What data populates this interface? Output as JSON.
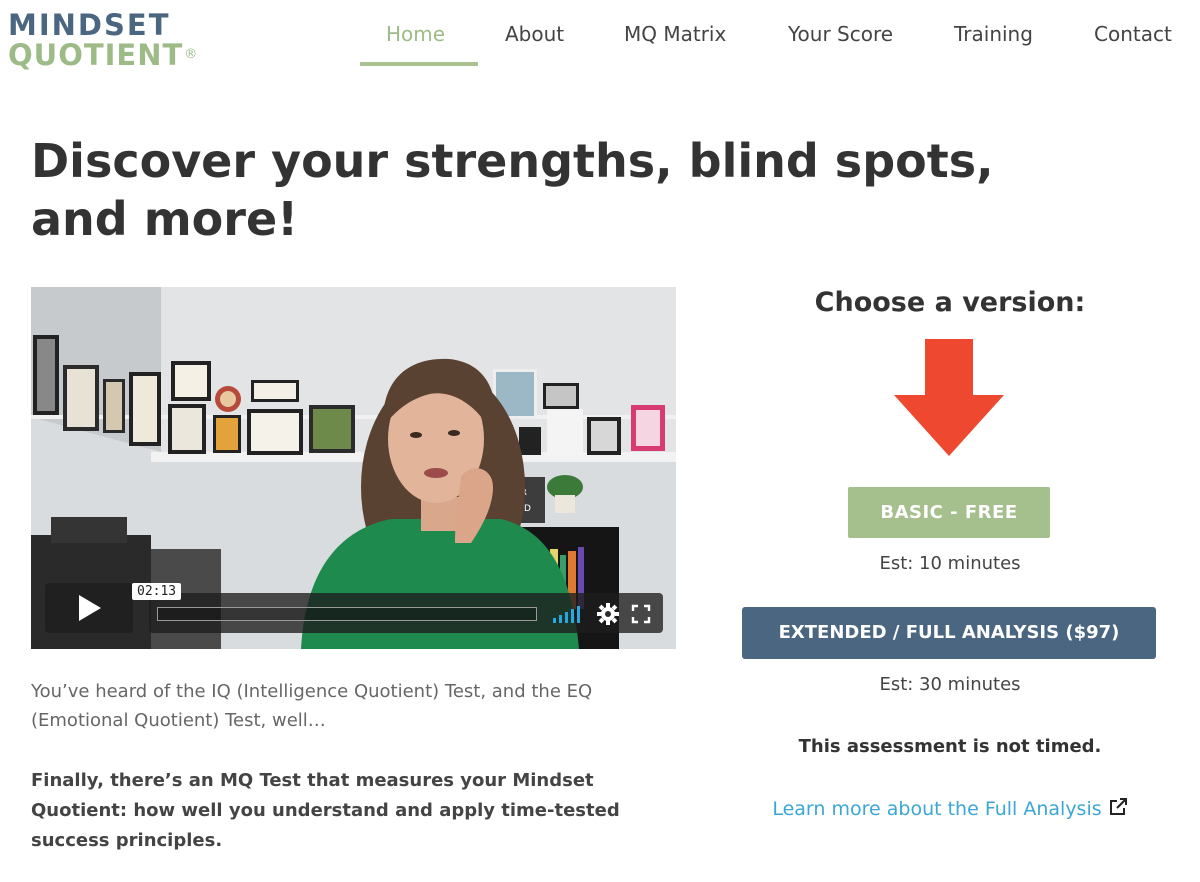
{
  "logo": {
    "line1": "MINDSET",
    "line2": "QUOTIENT",
    "reg": "®"
  },
  "nav": {
    "items": [
      {
        "label": "Home"
      },
      {
        "label": "About"
      },
      {
        "label": "MQ Matrix"
      },
      {
        "label": "Your Score"
      },
      {
        "label": "Training"
      },
      {
        "label": "Contact"
      }
    ],
    "active": "Home"
  },
  "headline": "Discover your strengths, blind spots, and more!",
  "video": {
    "time_badge": "02:13",
    "wall_sign": "YOUR BRAND",
    "icons": [
      "play-icon",
      "volume-icon",
      "gear-icon",
      "fullscreen-icon"
    ]
  },
  "intro": "You’ve heard of the IQ (Intelligence Quotient) Test, and the EQ (Emotional Quotient) Test, well…",
  "final": "Finally, there’s an MQ Test that measures your Mindset Quotient: how well you understand and apply time-tested success principles.",
  "choose": {
    "title": "Choose a version:",
    "arrow_color": "#ee4930",
    "basic_label": "BASIC - FREE",
    "basic_est": "Est: 10 minutes",
    "extended_label": "EXTENDED / FULL ANALYSIS ($97)",
    "extended_est": "Est: 30 minutes",
    "not_timed": "This assessment is not timed.",
    "learn_more": "Learn more about the Full Analysis"
  },
  "colors": {
    "green": "#a6c08d",
    "navy": "#4a6680",
    "link": "#3aa7d6",
    "arrow": "#ee4930"
  }
}
